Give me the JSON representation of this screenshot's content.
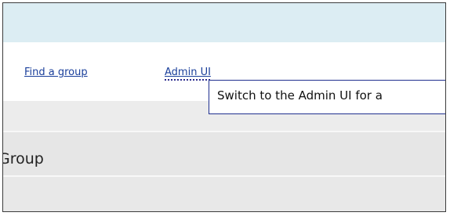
{
  "nav": {
    "find_group_label": "Find a group",
    "admin_ui_label": "Admin UI"
  },
  "tooltip": {
    "text": "Switch to the Admin UI for a"
  },
  "content": {
    "group_title": "Group"
  },
  "colors": {
    "header_band": "#dcedf3",
    "link": "#1a3f9b",
    "tooltip_border": "#1f2f8f",
    "panel_grey": "#e6e6e6"
  }
}
